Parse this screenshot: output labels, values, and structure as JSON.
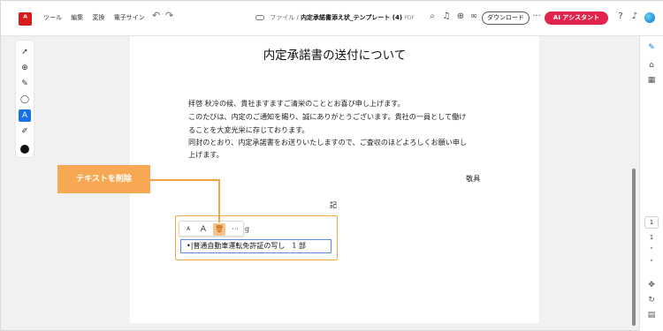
{
  "topbar": {
    "menu": [
      "ツール",
      "編集",
      "変換",
      "電子サイン"
    ],
    "file_prefix": "ファイル",
    "file_sep": "/",
    "file_name": "内定承諾書添え状_テンプレート (4)",
    "file_ext": "PDF",
    "download_label": "ダウンロード",
    "more_label": "···",
    "ai_label": "AI アシスタント"
  },
  "document": {
    "title": "内定承諾書の送付について",
    "paragraphs": [
      "拝啓 秋冷の候、貴社ますますご清栄のこととお喜び申し上げます。",
      "このたびは、内定のご通知を賜り、誠にありがとうございます。貴社の一員として働け",
      "ることを大変光栄に存じております。",
      "同封のとおり、内定承諾書をお送りいたしますので、ご査収のほどよろしくお願い申し",
      "上げます。"
    ],
    "closing": "敬具",
    "ki": "記",
    "behind_text": "g",
    "edit_text": "•|普通自動車運転免許証の写し　1 部"
  },
  "mini_toolbar": {
    "small_a": "A",
    "large_a": "A",
    "more": "···"
  },
  "callout": {
    "label": "テキストを削除"
  },
  "rail": {
    "page_current": "1",
    "page_total": "1"
  },
  "colors": {
    "accent_blue": "#1473e6",
    "callout_orange": "#f6a952",
    "ai_button": "#e0244b"
  }
}
